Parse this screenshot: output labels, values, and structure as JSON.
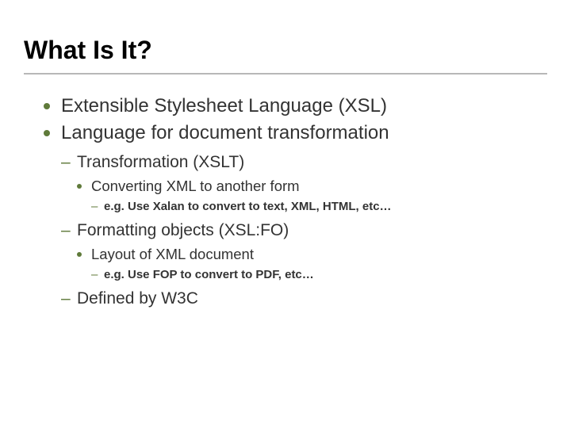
{
  "title": "What Is It?",
  "bullets": {
    "b1": "Extensible Stylesheet Language (XSL)",
    "b2": "Language for document transformation",
    "b2_1": "Transformation (XSLT)",
    "b2_1_1": "Converting XML to another form",
    "b2_1_1_1": "e.g. Use Xalan to convert to text, XML, HTML, etc…",
    "b2_2": "Formatting objects (XSL:FO)",
    "b2_2_1": "Layout of XML document",
    "b2_2_1_1": "e.g. Use FOP to convert to PDF, etc…",
    "b2_3": "Defined by W3C"
  }
}
